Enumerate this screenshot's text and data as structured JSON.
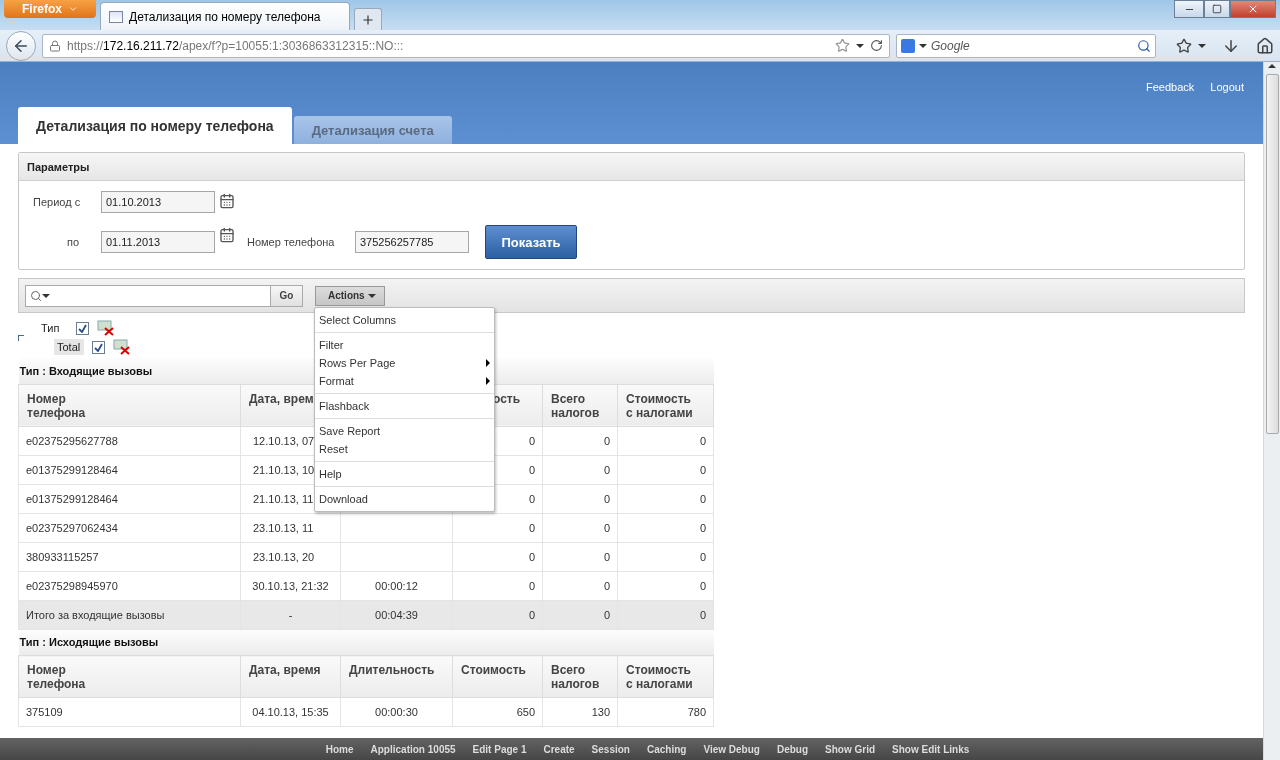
{
  "browser": {
    "menu_button": "Firefox",
    "tab_title": "Детализация по номеру телефона",
    "url": {
      "scheme": "https://",
      "host": "172.16.211.72",
      "path": "/apex/f?p=10055:1:3036863312315::NO:::"
    },
    "search_placeholder": "Google"
  },
  "header": {
    "links": [
      "Feedback",
      "Logout"
    ],
    "tabs": [
      {
        "label": "Детализация по номеру телефона",
        "selected": true
      },
      {
        "label": "Детализация счета",
        "selected": false
      }
    ]
  },
  "parameters": {
    "title": "Параметры",
    "period_from": {
      "label": "Период с",
      "value": "01.10.2013"
    },
    "period_to": {
      "label": "по",
      "value": "01.11.2013"
    },
    "phone": {
      "label": "Номер телефона",
      "value": "375256257785"
    },
    "submit": "Показать"
  },
  "report": {
    "go": "Go",
    "actions": "Actions",
    "menu": [
      [
        {
          "label": "Select Columns",
          "submenu": false
        }
      ],
      [
        {
          "label": "Filter",
          "submenu": false
        },
        {
          "label": "Rows Per Page",
          "submenu": true
        },
        {
          "label": "Format",
          "submenu": true
        }
      ],
      [
        {
          "label": "Flashback",
          "submenu": false
        }
      ],
      [
        {
          "label": "Save Report",
          "submenu": false
        },
        {
          "label": "Reset",
          "submenu": false
        }
      ],
      [
        {
          "label": "Help",
          "submenu": false
        }
      ],
      [
        {
          "label": "Download",
          "submenu": false
        }
      ]
    ],
    "tree": [
      {
        "label": "Тип",
        "checked": true,
        "highlighted": false
      },
      {
        "label": "Total",
        "checked": true,
        "highlighted": true
      }
    ],
    "groups": [
      {
        "title": "Тип : Входящие вызовы",
        "columns": [
          {
            "label": "Номер\nтелефона",
            "cut": false
          },
          {
            "label": "Дата, врем",
            "cut": false
          },
          {},
          {
            "label": "ость",
            "cut": true
          },
          {
            "label": "Всего\nналогов",
            "cut": false
          },
          {
            "label": "Стоимость\nс налогами",
            "cut": false
          }
        ],
        "rows": [
          {
            "total": false,
            "cut": true,
            "cells": [
              "e02375295627788",
              "12.10.13, 07",
              null,
              "0",
              "0",
              "0"
            ]
          },
          {
            "total": false,
            "cut": true,
            "cells": [
              "e01375299128464",
              "21.10.13, 10",
              null,
              "0",
              "0",
              "0"
            ]
          },
          {
            "total": false,
            "cut": true,
            "cells": [
              "e01375299128464",
              "21.10.13, 11",
              null,
              "0",
              "0",
              "0"
            ]
          },
          {
            "total": false,
            "cut": true,
            "cells": [
              "e02375297062434",
              "23.10.13, 11",
              null,
              "0",
              "0",
              "0"
            ]
          },
          {
            "total": false,
            "cut": true,
            "cells": [
              "380933115257",
              "23.10.13, 20",
              null,
              "0",
              "0",
              "0"
            ]
          },
          {
            "total": false,
            "cut": false,
            "cells": [
              "e02375298945970",
              "30.10.13, 21:32",
              "00:00:12",
              "0",
              "0",
              "0"
            ]
          },
          {
            "total": true,
            "cut": false,
            "cells": [
              "Итого за входящие вызовы",
              "-",
              "00:04:39",
              "0",
              "0",
              "0"
            ]
          }
        ]
      },
      {
        "title": "Тип : Исходящие вызовы",
        "columns": [
          {
            "label": "Номер\nтелефона",
            "cut": false
          },
          {
            "label": "Дата, время",
            "cut": false
          },
          {
            "label": "Длительность",
            "cut": false
          },
          {
            "label": "Стоимость",
            "cut": false
          },
          {
            "label": "Всего\nналогов",
            "cut": false
          },
          {
            "label": "Стоимость\nс налогами",
            "cut": false
          }
        ],
        "rows": [
          {
            "total": false,
            "cut": false,
            "cells": [
              "375109",
              "04.10.13, 15:35",
              "00:00:30",
              "650",
              "130",
              "780"
            ]
          }
        ]
      }
    ]
  },
  "dev_bar": [
    "Home",
    "Application 10055",
    "Edit Page 1",
    "Create",
    "Session",
    "Caching",
    "View Debug",
    "Debug",
    "Show Grid",
    "Show Edit Links"
  ]
}
